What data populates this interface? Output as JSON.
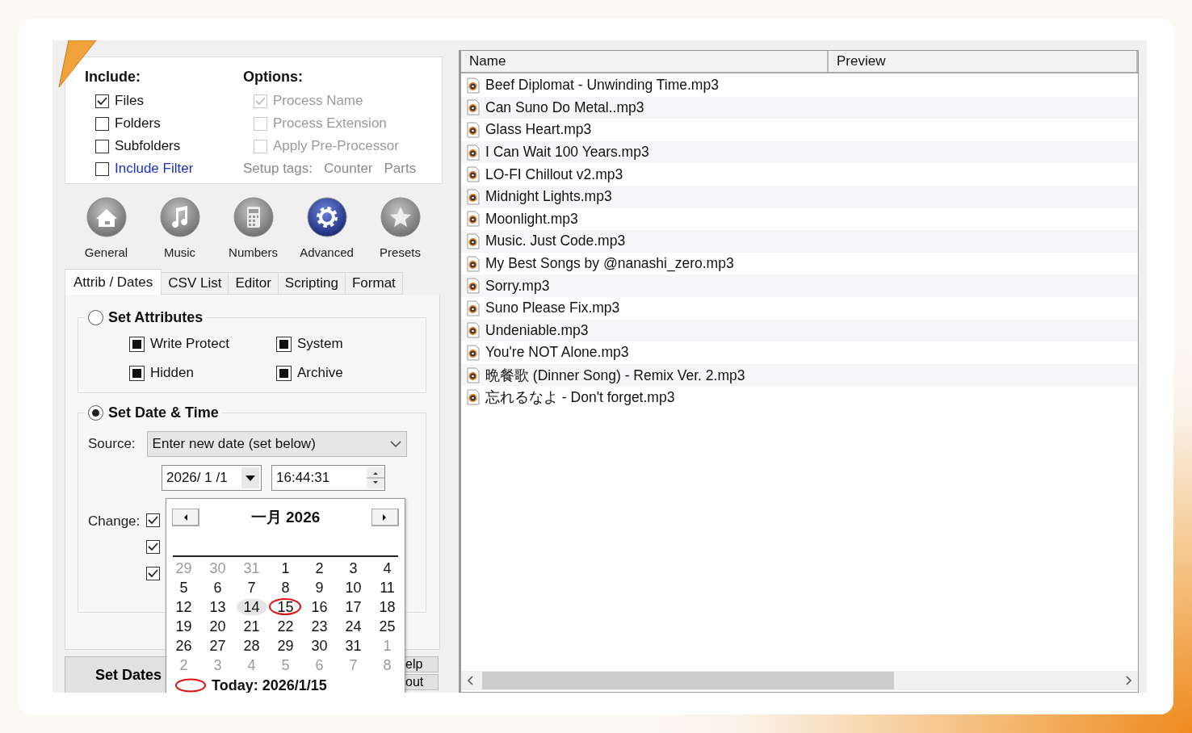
{
  "include": {
    "title": "Include:",
    "items": [
      {
        "label": "Files",
        "checked": true,
        "kind": "plain"
      },
      {
        "label": "Folders",
        "checked": false,
        "kind": "plain"
      },
      {
        "label": "Subfolders",
        "checked": false,
        "kind": "plain"
      },
      {
        "label": "Include Filter",
        "checked": false,
        "kind": "link"
      }
    ]
  },
  "options": {
    "title": "Options:",
    "items": [
      {
        "label": "Process Name",
        "checked": true,
        "disabled": true
      },
      {
        "label": "Process Extension",
        "checked": false,
        "disabled": true
      },
      {
        "label": "Apply Pre-Processor",
        "checked": false,
        "disabled": true
      }
    ],
    "setup_tags": [
      "Setup tags:",
      "Counter",
      "Parts"
    ]
  },
  "modes": [
    {
      "label": "General",
      "selected": false
    },
    {
      "label": "Music",
      "selected": false
    },
    {
      "label": "Numbers",
      "selected": false
    },
    {
      "label": "Advanced",
      "selected": true
    },
    {
      "label": "Presets",
      "selected": false
    }
  ],
  "tabs": [
    {
      "label": "Attrib / Dates",
      "selected": true
    },
    {
      "label": "CSV List",
      "selected": false
    },
    {
      "label": "Editor",
      "selected": false
    },
    {
      "label": "Scripting",
      "selected": false
    },
    {
      "label": "Format",
      "selected": false
    }
  ],
  "attributes": {
    "label": "Set Attributes",
    "selected": false,
    "items": [
      {
        "label": "Write Protect",
        "checked": true
      },
      {
        "label": "System",
        "checked": true
      },
      {
        "label": "Hidden",
        "checked": true
      },
      {
        "label": "Archive",
        "checked": true
      }
    ]
  },
  "date_time": {
    "label": "Set Date & Time",
    "selected": true,
    "source_label": "Source:",
    "source_value": "Enter new date (set below)",
    "date": "2026/ 1 /1",
    "time": "16:44:31",
    "change_label": "Change:",
    "change_checks": [
      {
        "checked": true
      },
      {
        "checked": true
      },
      {
        "checked": true
      }
    ]
  },
  "buttons": [
    {
      "label": "Set Dates",
      "kind": "main"
    },
    {
      "label": "elp",
      "kind": "small"
    },
    {
      "label": "out",
      "kind": "small"
    }
  ],
  "calendar": {
    "month": "一月 2026",
    "today_label": "Today: 2026/1/15",
    "weeks": [
      [
        {
          "day": "29",
          "muted": true,
          "selected": false,
          "today": false
        },
        {
          "day": "30",
          "muted": true,
          "selected": false,
          "today": false
        },
        {
          "day": "31",
          "muted": true,
          "selected": false,
          "today": false
        },
        {
          "day": "1",
          "muted": false,
          "selected": false,
          "today": false
        },
        {
          "day": "2",
          "muted": false,
          "selected": false,
          "today": false
        },
        {
          "day": "3",
          "muted": false,
          "selected": false,
          "today": false
        },
        {
          "day": "4",
          "muted": false,
          "selected": false,
          "today": false
        }
      ],
      [
        {
          "day": "5",
          "muted": false,
          "selected": false,
          "today": false
        },
        {
          "day": "6",
          "muted": false,
          "selected": false,
          "today": false
        },
        {
          "day": "7",
          "muted": false,
          "selected": false,
          "today": false
        },
        {
          "day": "8",
          "muted": false,
          "selected": false,
          "today": false
        },
        {
          "day": "9",
          "muted": false,
          "selected": false,
          "today": false
        },
        {
          "day": "10",
          "muted": false,
          "selected": false,
          "today": false
        },
        {
          "day": "11",
          "muted": false,
          "selected": false,
          "today": false
        }
      ],
      [
        {
          "day": "12",
          "muted": false,
          "selected": false,
          "today": false
        },
        {
          "day": "13",
          "muted": false,
          "selected": false,
          "today": false
        },
        {
          "day": "14",
          "muted": false,
          "selected": true,
          "today": false
        },
        {
          "day": "15",
          "muted": false,
          "selected": false,
          "today": true
        },
        {
          "day": "16",
          "muted": false,
          "selected": false,
          "today": false
        },
        {
          "day": "17",
          "muted": false,
          "selected": false,
          "today": false
        },
        {
          "day": "18",
          "muted": false,
          "selected": false,
          "today": false
        }
      ],
      [
        {
          "day": "19",
          "muted": false,
          "selected": false,
          "today": false
        },
        {
          "day": "20",
          "muted": false,
          "selected": false,
          "today": false
        },
        {
          "day": "21",
          "muted": false,
          "selected": false,
          "today": false
        },
        {
          "day": "22",
          "muted": false,
          "selected": false,
          "today": false
        },
        {
          "day": "23",
          "muted": false,
          "selected": false,
          "today": false
        },
        {
          "day": "24",
          "muted": false,
          "selected": false,
          "today": false
        },
        {
          "day": "25",
          "muted": false,
          "selected": false,
          "today": false
        }
      ],
      [
        {
          "day": "26",
          "muted": false,
          "selected": false,
          "today": false
        },
        {
          "day": "27",
          "muted": false,
          "selected": false,
          "today": false
        },
        {
          "day": "28",
          "muted": false,
          "selected": false,
          "today": false
        },
        {
          "day": "29",
          "muted": false,
          "selected": false,
          "today": false
        },
        {
          "day": "30",
          "muted": false,
          "selected": false,
          "today": false
        },
        {
          "day": "31",
          "muted": false,
          "selected": false,
          "today": false
        },
        {
          "day": "1",
          "muted": true,
          "selected": false,
          "today": false
        }
      ],
      [
        {
          "day": "2",
          "muted": true,
          "selected": false,
          "today": false
        },
        {
          "day": "3",
          "muted": true,
          "selected": false,
          "today": false
        },
        {
          "day": "4",
          "muted": true,
          "selected": false,
          "today": false
        },
        {
          "day": "5",
          "muted": true,
          "selected": false,
          "today": false
        },
        {
          "day": "6",
          "muted": true,
          "selected": false,
          "today": false
        },
        {
          "day": "7",
          "muted": true,
          "selected": false,
          "today": false
        },
        {
          "day": "8",
          "muted": true,
          "selected": false,
          "today": false
        }
      ]
    ]
  },
  "files": {
    "columns": [
      "Name",
      "Preview"
    ],
    "rows": [
      "Beef Diplomat - Unwinding Time.mp3",
      "Can Suno Do Metal..mp3",
      "Glass Heart.mp3",
      "I Can Wait 100 Years.mp3",
      "LO-FI Chillout v2.mp3",
      "Midnight Lights.mp3",
      "Moonlight.mp3",
      "Music. Just Code.mp3",
      "My Best Songs by @nanashi_zero.mp3",
      "Sorry.mp3",
      "Suno Please Fix.mp3",
      "Undeniable.mp3",
      "You're NOT Alone.mp3",
      "晩餐歌 (Dinner Song) - Remix Ver. 2.mp3",
      "忘れるなよ - Don't forget.mp3"
    ]
  }
}
